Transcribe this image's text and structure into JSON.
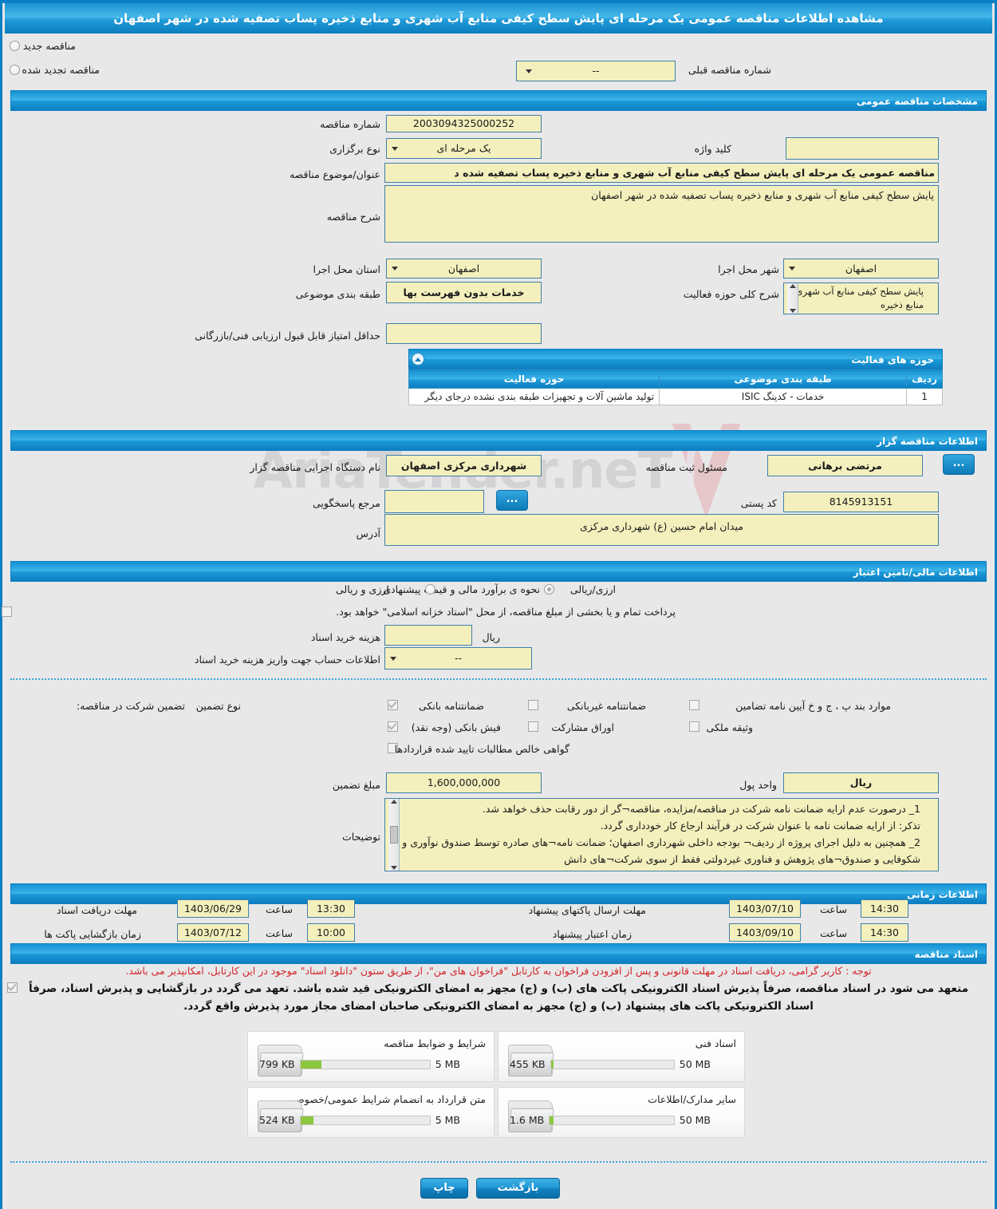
{
  "page": {
    "title": "مشاهده اطلاعات مناقصه عمومی یک مرحله ای پایش سطح کیفی منابع آب شهری و منابع ذخیره پساب تصفیه شده در شهر اصفهان"
  },
  "tender_type": {
    "new_label": "مناقصه جدید",
    "renewed_label": "مناقصه تجدید شده",
    "prev_number_label": "شماره مناقصه قبلی",
    "prev_number_value": "--"
  },
  "general": {
    "section_title": "مشخصات مناقصه عمومی",
    "tender_number_label": "شماره مناقصه",
    "tender_number_value": "2003094325000252",
    "holding_type_label": "نوع برگزاری",
    "holding_type_value": "یک مرحله ای",
    "keyword_label": "کلید واژه",
    "keyword_value": "",
    "subject_label": "عنوان/موضوع مناقصه",
    "subject_value": "مناقصه عمومی یک مرحله ای پایش سطح کیفی منابع آب شهری و منابع ذخیره پساب تصفیه شده د",
    "description_label": "شرح مناقصه",
    "description_value": "پایش سطح کیفی منابع آب شهری و منابع ذخیره پساب تصفیه شده در شهر اصفهان",
    "province_label": "استان محل اجرا",
    "province_value": "اصفهان",
    "city_label": "شهر محل اجرا",
    "city_value": "اصفهان",
    "classification_label": "طبقه بندی موضوعی",
    "classification_value": "خدمات بدون فهرست بها",
    "activity_summary_label": "شرح کلی حوزه فعالیت",
    "activity_summary_value": "پایش سطح کیفی منابع آب شهری و منابع ذخیره",
    "min_score_label": "حداقل امتیاز قابل قبول ارزیابی فنی/بازرگانی",
    "min_score_value": ""
  },
  "activity_areas": {
    "section_title": "حوزه های فعالیت",
    "columns": [
      "ردیف",
      "طبقه بندی موضوعی",
      "حوزه فعالیت"
    ],
    "rows": [
      {
        "row": "1",
        "classification": "خدمات - کدینگ ISIC",
        "area": "تولید ماشین آلات و تجهیزات طبقه بندی نشده درجای دیگر"
      }
    ]
  },
  "organizer": {
    "section_title": "اطلاعات مناقصه گزار",
    "executive_agency_label": "نام دستگاه اجرایی مناقصه گزار",
    "executive_agency_value": "شهرداری مرکزی اصفهان",
    "registrar_label": "مسئول ثبت مناقصه",
    "registrar_value": "مرتضی برهانی",
    "lookup_label": "...",
    "answer_reference_label": "مرجع پاسخگویی",
    "answer_reference_value": "",
    "postal_code_label": "کد پستی",
    "postal_code_value": "8145913151",
    "address_label": "آدرس",
    "address_value": "میدان امام حسین (ع) شهرداری مرکزی"
  },
  "financial": {
    "section_title": "اطلاعات مالی/تامین اعتبار",
    "estimate_label": "نحوه ی برآورد مالی و قیمت پیشنهادی",
    "option_currency_rial": "ارزی/ریالی",
    "option_currency_and_rial": "ارزی و ریالی",
    "islamic_treasury_note": "پرداخت تمام و یا بخشی از مبلغ مناقصه، از محل \"اسناد خزانه اسلامی\" خواهد بود.",
    "doc_cost_label": "هزینه خرید اسناد",
    "doc_cost_value": "",
    "doc_cost_currency": "ریال",
    "account_info_label": "اطلاعات حساب جهت واریز هزینه خرید اسناد",
    "account_info_value": "--"
  },
  "guarantee": {
    "participation_label": "تضمین شرکت در مناقصه:",
    "type_label": "نوع تضمین",
    "options": [
      {
        "label": "ضمانتنامه بانکی",
        "checked": true
      },
      {
        "label": "ضمانتنامه غیربانکی",
        "checked": false
      },
      {
        "label": "موارد بند پ ، ج و خ آیین نامه تضامین",
        "checked": false
      },
      {
        "label": "فیش بانکی (وجه نقد)",
        "checked": true
      },
      {
        "label": "اوراق مشارکت",
        "checked": false
      },
      {
        "label": "وثیقه ملکی",
        "checked": false
      },
      {
        "label": "گواهی خالص مطالبات تایید شده قراردادها",
        "checked": false
      }
    ],
    "amount_label": "مبلغ تضمین",
    "amount_value": "1,600,000,000",
    "currency_label": "واحد پول",
    "currency_value": "ریال",
    "notes_label": "توضیحات",
    "notes_value": "1_ درصورت عدم ارایه ضمانت نامه شرکت در مناقصه/مزایده، مناقصه¬گر از دور رقابت حذف خواهد شد.\nتذکر: از ارایه ضمانت نامه با عنوان شرکت در فرآیند ارجاع کار خودداری گردد.\n2_ همچنین به دلیل اجرای پروژه از ردیف¬ بودجه داخلی شهرداری اصفهان؛ ضمانت نامه¬های صادره توسط صندوق نوآوری و شکوفایی و صندوق¬های پژوهش و فناوری غیردولتی فقط از سوی شرکت¬های دانش"
  },
  "timing": {
    "section_title": "اطلاعات زمانی",
    "doc_receipt_deadline_label": "مهلت دریافت اسناد",
    "doc_receipt_deadline_date": "1403/06/29",
    "doc_receipt_deadline_time_label": "ساعت",
    "doc_receipt_deadline_time": "13:30",
    "proposal_send_deadline_label": "مهلت ارسال پاکتهای پیشنهاد",
    "proposal_send_deadline_date": "1403/07/10",
    "proposal_send_deadline_time_label": "ساعت",
    "proposal_send_deadline_time": "14:30",
    "opening_label": "زمان بازگشایی پاکت ها",
    "opening_date": "1403/07/12",
    "opening_time_label": "ساعت",
    "opening_time": "10:00",
    "validity_label": "زمان اعتبار پیشنهاد",
    "validity_date": "1403/09/10",
    "validity_time_label": "ساعت",
    "validity_time": "14:30"
  },
  "documents": {
    "section_title": "اسناد مناقصه",
    "notice_red": "توجه : کاربر گرامی، دریافت اسناد در مهلت قانونی و پس از افزودن فراخوان به کارتابل \"فراخوان های من\"، از طریق ستون \"دانلود اسناد\" موجود در این کارتابل، امکانپذیر می باشد.",
    "notice_black": "متعهد می شود در اسناد مناقصه، صرفاً پذیرش اسناد الکترونیکی پاکت های (ب) و (ج) مجهز به امضای الکترونیکی قید شده باشد. تعهد می گردد در بازگشایی و پذیرش اسناد، صرفاً اسناد الکترونیکی پاکت های پیشنهاد (ب) و (ج) مجهز به امضای الکترونیکی صاحبان امضای مجاز مورد پذیرش واقع گردد.",
    "files": [
      {
        "name": "شرایط و ضوابط مناقصه",
        "size": "799 KB",
        "max": "5 MB",
        "fill_pct": 16
      },
      {
        "name": "اسناد فنی",
        "size": "455 KB",
        "max": "50 MB",
        "fill_pct": 2
      },
      {
        "name": "متن قرارداد به انضمام شرایط عمومی/خصوصی",
        "size": "524 KB",
        "max": "5 MB",
        "fill_pct": 10
      },
      {
        "name": "سایر مدارک/اطلاعات",
        "size": "1.6 MB",
        "max": "50 MB",
        "fill_pct": 3
      }
    ]
  },
  "footer": {
    "print_label": "چاپ",
    "back_label": "بازگشت"
  }
}
